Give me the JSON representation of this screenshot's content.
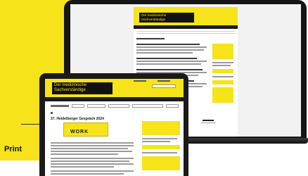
{
  "left_caption": "Print",
  "colors": {
    "brand_yellow": "#f6e31a",
    "device_black": "#151515"
  },
  "laptop_site": {
    "logo_line1": "Der medizinische",
    "logo_line2": "Sachverständige"
  },
  "tablet_site": {
    "logo_line1": "Der medizinische",
    "logo_line2": "Sachverständige",
    "article_title": "37. Heidelberger Gespräch 2024",
    "image_word": "WORK"
  }
}
